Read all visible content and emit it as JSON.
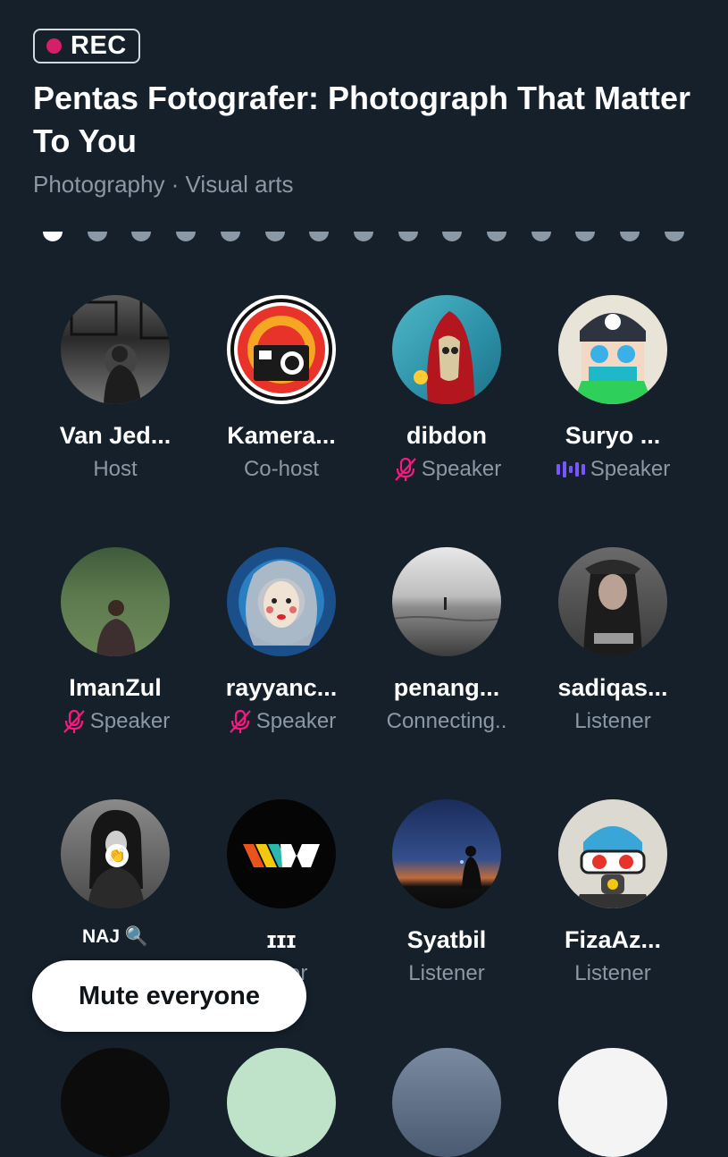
{
  "rec_label": "REC",
  "space": {
    "title": "Pentas Fotografer: Photograph That Matter To You",
    "topics": "Photography · Visual arts"
  },
  "pager": {
    "total": 15,
    "active_index": 0
  },
  "participants": [
    {
      "name": "Van Jed...",
      "role": "Host",
      "role_icon": "",
      "avatar_icon": "user-photo-icon"
    },
    {
      "name": "Kamera...",
      "role": "Co-host",
      "role_icon": "",
      "avatar_icon": "camera-logo-icon"
    },
    {
      "name": "dibdon",
      "role": "Speaker",
      "role_icon": "mic-muted-icon",
      "avatar_icon": "hooded-skull-art-icon"
    },
    {
      "name": "Suryo ...",
      "role": "Speaker",
      "role_icon": "speaking-waveform-icon",
      "avatar_icon": "cartoon-character-icon"
    },
    {
      "name": "ImanZul",
      "role": "Speaker",
      "role_icon": "mic-muted-icon",
      "avatar_icon": "user-photo-icon"
    },
    {
      "name": "rayyanc...",
      "role": "Speaker",
      "role_icon": "mic-muted-icon",
      "avatar_icon": "portrait-art-icon"
    },
    {
      "name": "penang...",
      "role": "Connecting..",
      "role_icon": "",
      "avatar_icon": "seascape-photo-icon"
    },
    {
      "name": "sadiqas...",
      "role": "Listener",
      "role_icon": "",
      "avatar_icon": "user-photo-icon"
    },
    {
      "name": "NAJ 🔍",
      "role": "",
      "role_icon": "",
      "avatar_icon": "user-photo-icon",
      "emoji_badge": "👏"
    },
    {
      "name": "ɪɪɪ",
      "role": "…ner",
      "role_icon": "",
      "avatar_icon": "w-logo-icon"
    },
    {
      "name": "Syatbil",
      "role": "Listener",
      "role_icon": "",
      "avatar_icon": "night-sky-photo-icon"
    },
    {
      "name": "FizaAz...",
      "role": "Listener",
      "role_icon": "",
      "avatar_icon": "cartoon-character-icon"
    }
  ],
  "mute_button_label": "Mute everyone",
  "colors": {
    "background": "#15202b",
    "muted_text": "#8b98a5",
    "rec_dot": "#d61f69",
    "mic_muted": "#f91880",
    "speaking": "#7856ff"
  }
}
